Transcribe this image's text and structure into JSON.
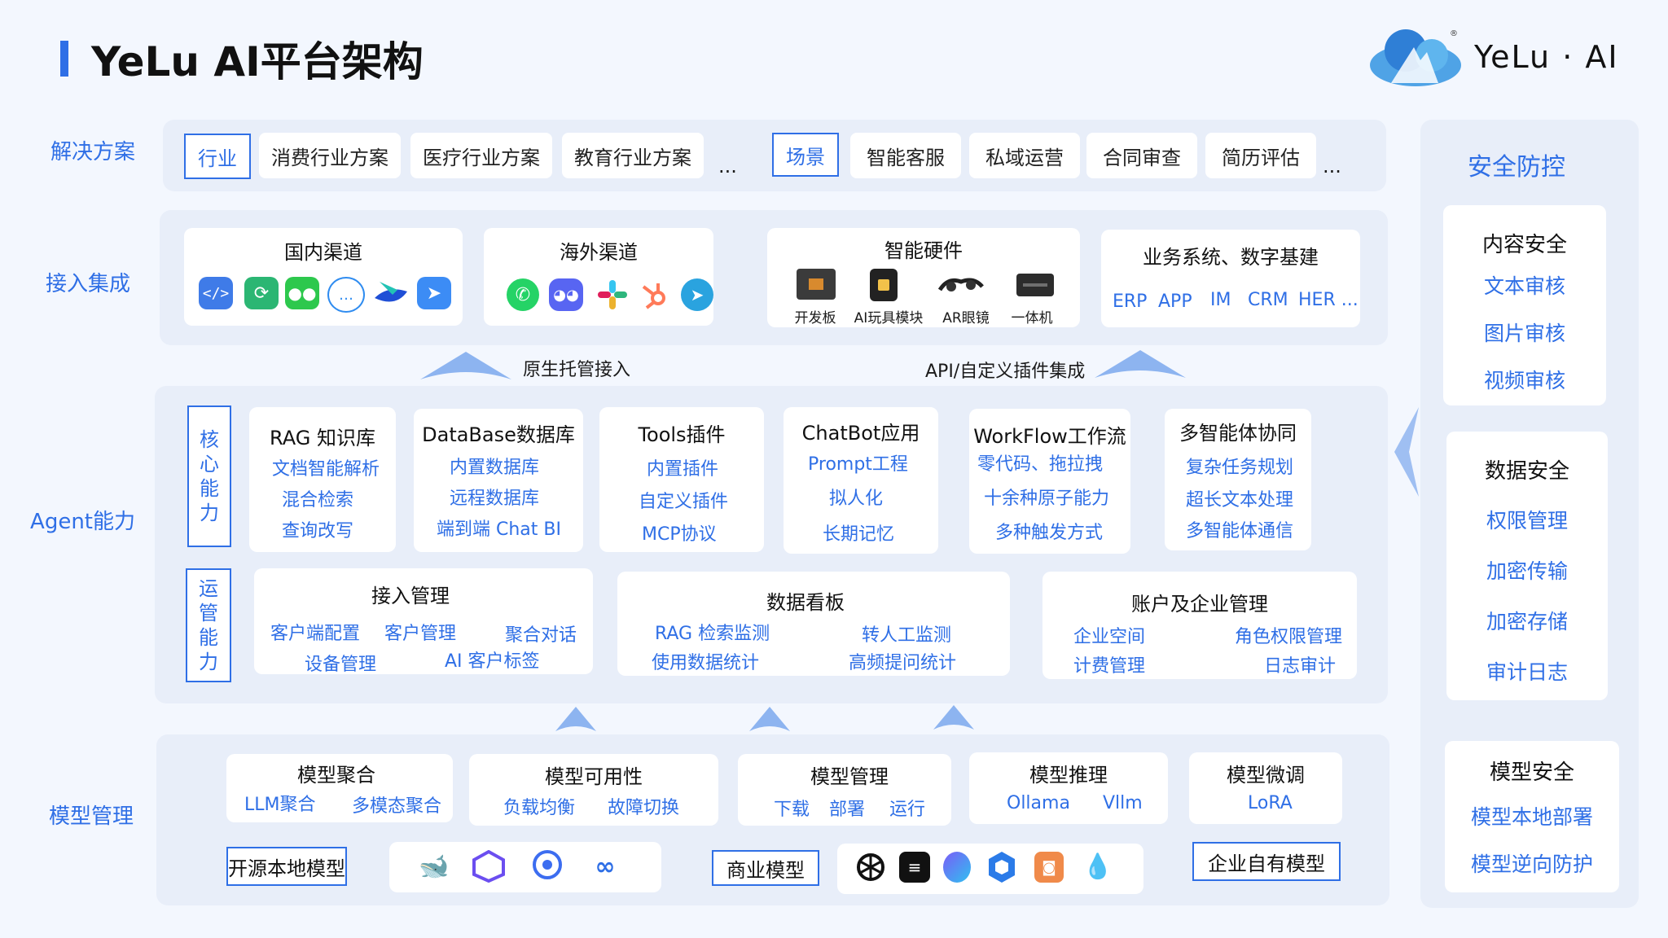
{
  "header": {
    "title": "YeLu AI平台架构",
    "brand": "YeLu · AI"
  },
  "row_labels": {
    "solutions": "解决方案",
    "integration": "接入集成",
    "agent": "Agent能力",
    "models": "模型管理"
  },
  "solutions": {
    "industry_tag": "行业",
    "industry_items": [
      "消费行业方案",
      "医疗行业方案",
      "教育行业方案"
    ],
    "industry_more": "...",
    "scene_tag": "场景",
    "scene_items": [
      "智能客服",
      "私域运营",
      "合同审查",
      "简历评估"
    ],
    "scene_more": "..."
  },
  "integration": {
    "domestic": {
      "title": "国内渠道"
    },
    "overseas": {
      "title": "海外渠道"
    },
    "hardware": {
      "title": "智能硬件",
      "items": [
        "开发板",
        "AI玩具模块",
        "AR眼镜",
        "一体机"
      ]
    },
    "business": {
      "title": "业务系统、数字基建",
      "items": [
        "ERP",
        "APP",
        "IM",
        "CRM",
        "HER ..."
      ]
    }
  },
  "connectors": {
    "native": "原生托管接入",
    "api": "API/自定义插件集成"
  },
  "agent": {
    "core_label": [
      "核",
      "心",
      "能",
      "力"
    ],
    "ops_label": [
      "运",
      "管",
      "能",
      "力"
    ],
    "core": [
      {
        "title": "RAG 知识库",
        "items": [
          "文档智能解析",
          "混合检索",
          "查询改写"
        ]
      },
      {
        "title": "DataBase数据库",
        "items": [
          "内置数据库",
          "远程数据库",
          "端到端 Chat BI"
        ]
      },
      {
        "title": "Tools插件",
        "items": [
          "内置插件",
          "自定义插件",
          "MCP协议"
        ]
      },
      {
        "title": "ChatBot应用",
        "items": [
          "Prompt工程",
          "拟人化",
          "长期记忆"
        ]
      },
      {
        "title": "WorkFlow工作流",
        "items": [
          "零代码、拖拉拽",
          "十余种原子能力",
          "多种触发方式"
        ]
      },
      {
        "title": "多智能体协同",
        "items": [
          "复杂任务规划",
          "超长文本处理",
          "多智能体通信"
        ]
      }
    ],
    "ops": [
      {
        "title": "接入管理",
        "items": [
          "客户端配置",
          "客户管理",
          "聚合对话",
          "设备管理",
          "AI 客户标签"
        ]
      },
      {
        "title": "数据看板",
        "items": [
          "RAG 检索监测",
          "转人工监测",
          "使用数据统计",
          "高频提问统计"
        ]
      },
      {
        "title": "账户及企业管理",
        "items": [
          "企业空间",
          "角色权限管理",
          "计费管理",
          "日志审计"
        ]
      }
    ]
  },
  "models": {
    "groups": [
      {
        "title": "模型聚合",
        "items": [
          "LLM聚合",
          "多模态聚合"
        ]
      },
      {
        "title": "模型可用性",
        "items": [
          "负载均衡",
          "故障切换"
        ]
      },
      {
        "title": "模型管理",
        "items": [
          "下载",
          "部署",
          "运行"
        ]
      },
      {
        "title": "模型推理",
        "items": [
          "Ollama",
          "Vllm"
        ]
      },
      {
        "title": "模型微调",
        "items": [
          "LoRA"
        ]
      }
    ],
    "open_source": "开源本地模型",
    "commercial": "商业模型",
    "enterprise": "企业自有模型"
  },
  "security": {
    "title": "安全防控",
    "groups": [
      {
        "title": "内容安全",
        "items": [
          "文本审核",
          "图片审核",
          "视频审核"
        ]
      },
      {
        "title": "数据安全",
        "items": [
          "权限管理",
          "加密传输",
          "加密存储",
          "审计日志"
        ]
      },
      {
        "title": "模型安全",
        "items": [
          "模型本地部署",
          "模型逆向防护"
        ]
      }
    ]
  },
  "colors": {
    "accent": "#2f6fe6",
    "panel": "#e8eef9",
    "background": "#f3f7fe"
  }
}
